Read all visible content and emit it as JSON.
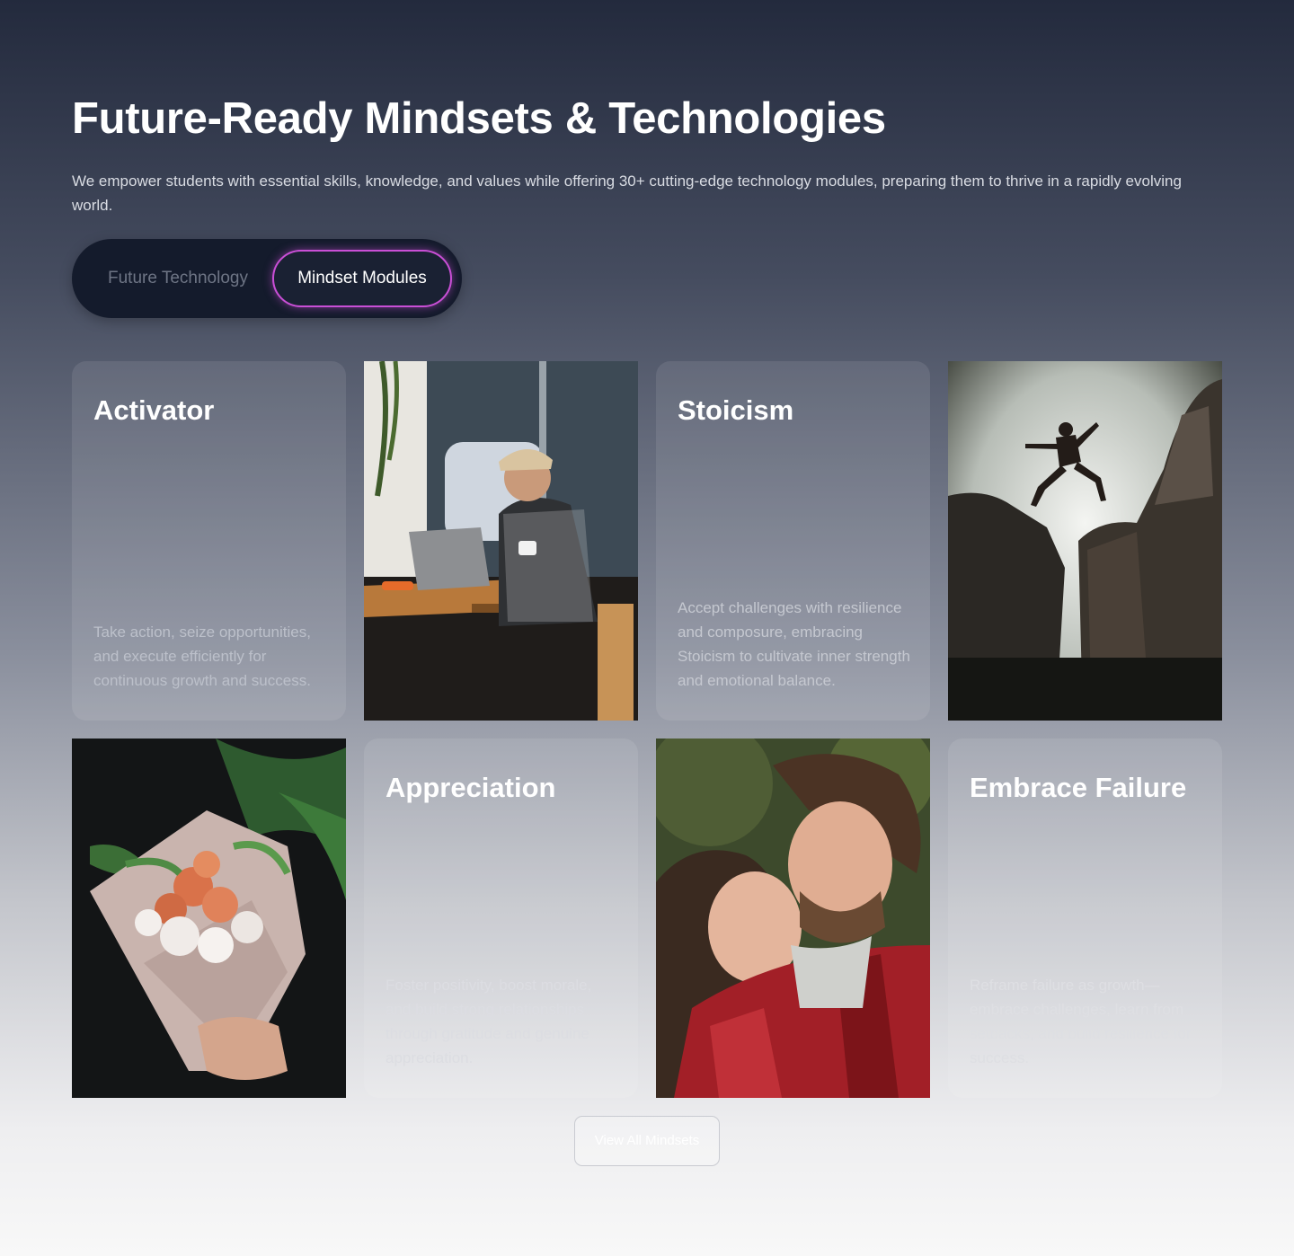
{
  "header": {
    "title": "Future-Ready Mindsets & Technologies",
    "subtitle": "We empower students with essential skills, knowledge, and values while offering 30+ cutting-edge technology modules, preparing them to thrive in a rapidly evolving world."
  },
  "toggle": {
    "tabs": [
      {
        "label": "Future Technology",
        "active": false
      },
      {
        "label": "Mindset Modules",
        "active": true
      }
    ],
    "accent": "#c94fd6"
  },
  "cards": [
    {
      "title": "Activator",
      "description": "Take action, seize opportunities, and execute efficiently for continuous growth and success."
    },
    {
      "title": "Stoicism",
      "description": "Accept challenges with resilience and composure, embracing Stoicism to cultivate inner strength and emotional balance."
    },
    {
      "title": "Appreciation",
      "description": "Foster positivity, boost morale, and build strong relationships through gratitude and genuine appreciation."
    },
    {
      "title": "Embrace Failure",
      "description": "Reframe failure as growth—embrace challenges, learn from setbacks, and build resilience for success."
    }
  ],
  "photos": [
    {
      "icon": "man-with-laptop-photo"
    },
    {
      "icon": "person-jumping-cliffs-photo"
    },
    {
      "icon": "flower-bouquet-photo"
    },
    {
      "icon": "smiling-couple-photo"
    }
  ],
  "footer": {
    "view_all_label": "View All Mindsets"
  }
}
